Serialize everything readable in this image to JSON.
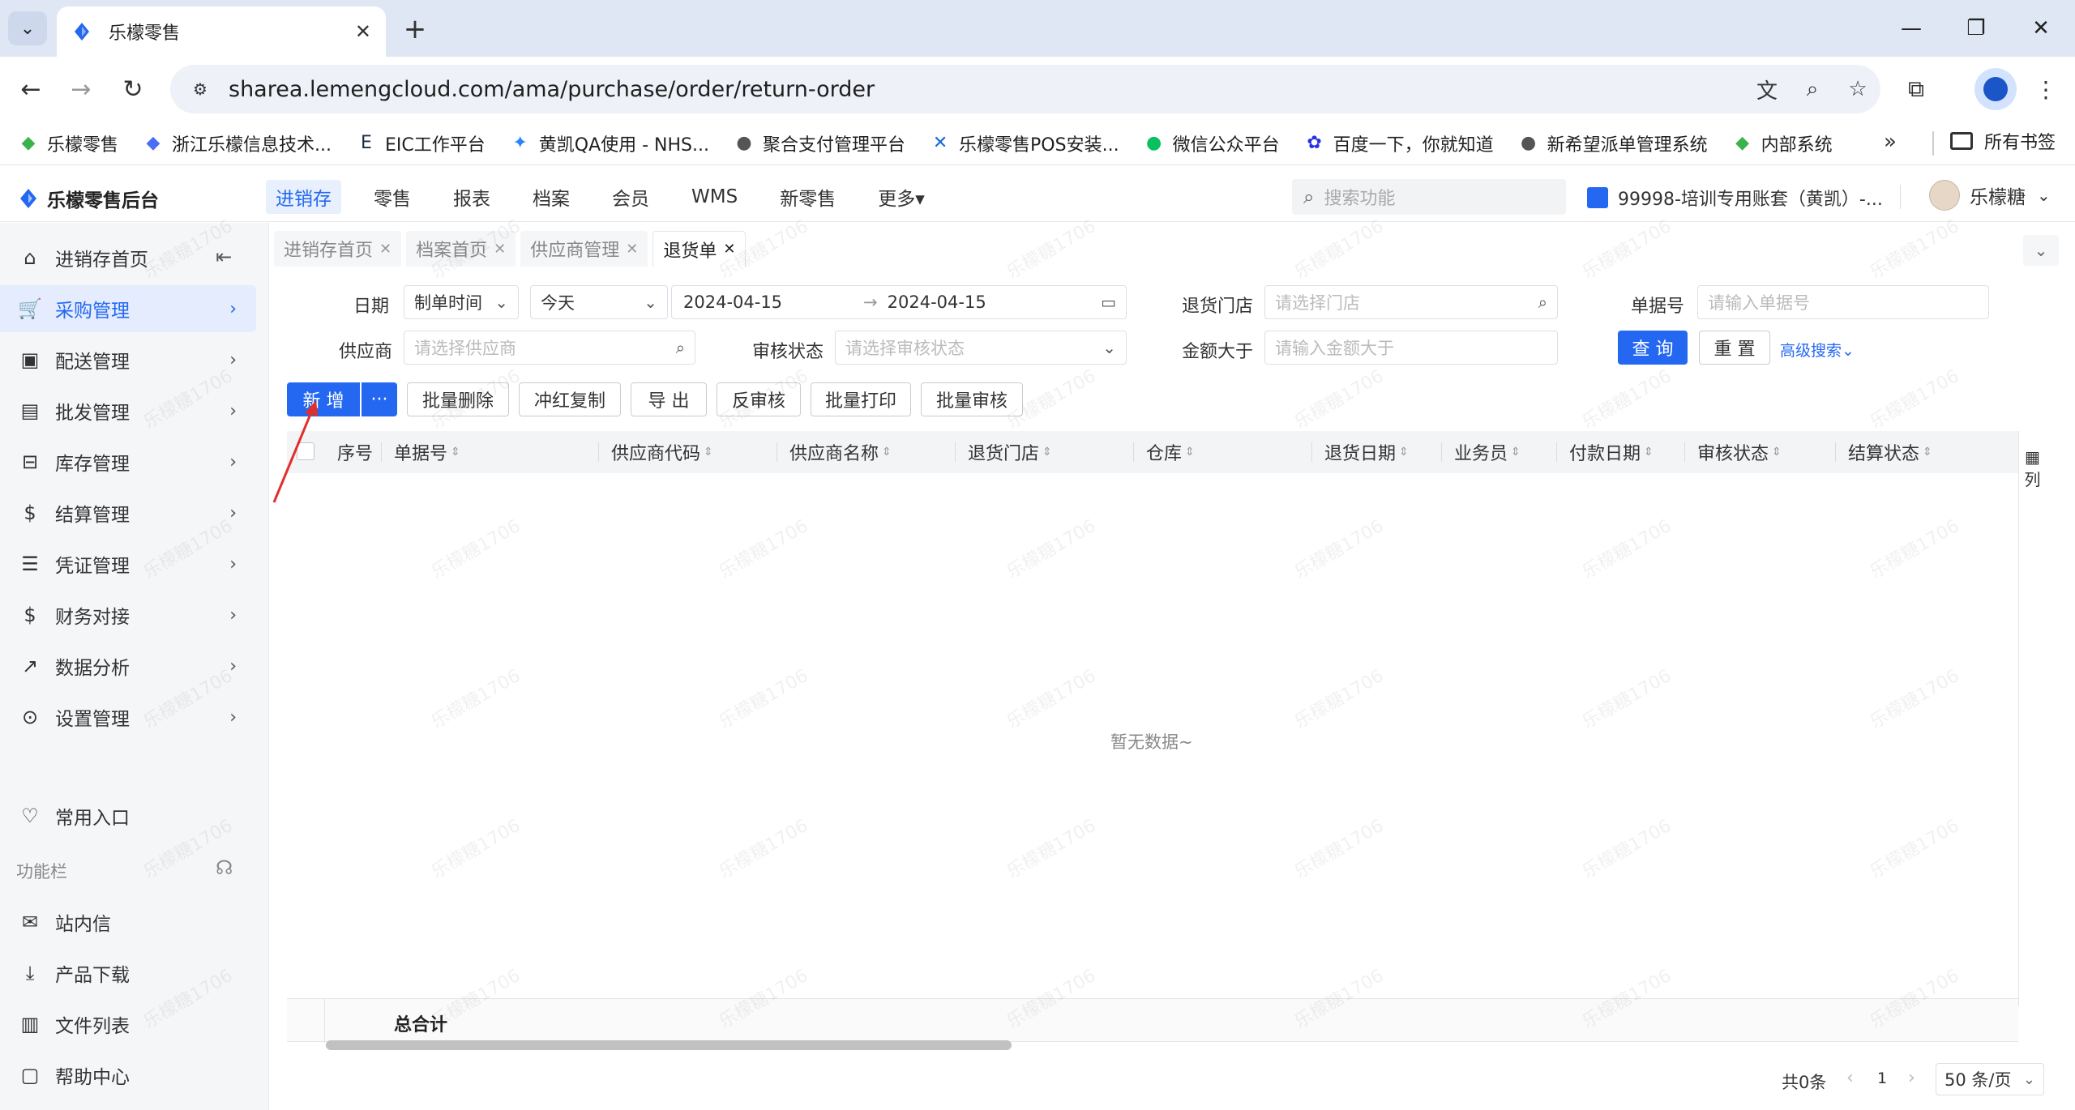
{
  "browser": {
    "tab_title": "乐檬零售",
    "url": "sharea.lemengcloud.com/ama/purchase/order/return-order",
    "bookmarks": [
      {
        "label": "乐檬零售",
        "icon": "lemeng-icon",
        "color": "#3bb34a"
      },
      {
        "label": "浙江乐檬信息技术...",
        "icon": "lemeng-blue-icon",
        "color": "#4a6cf7"
      },
      {
        "label": "EIC工作平台",
        "icon": "eic-icon",
        "color": "#1b2b4a"
      },
      {
        "label": "黄凯QA使用 - NHS...",
        "icon": "jira-icon",
        "color": "#2684ff"
      },
      {
        "label": "聚合支付管理平台",
        "icon": "globe-icon",
        "color": "#555555"
      },
      {
        "label": "乐檬零售POS安装...",
        "icon": "confluence-icon",
        "color": "#1868db"
      },
      {
        "label": "微信公众平台",
        "icon": "wechat-icon",
        "color": "#07c160"
      },
      {
        "label": "百度一下，你就知道",
        "icon": "baidu-icon",
        "color": "#2932e1"
      },
      {
        "label": "新希望派单管理系统",
        "icon": "globe-icon",
        "color": "#555555"
      },
      {
        "label": "内部系统",
        "icon": "lemeng-icon",
        "color": "#3bb34a"
      }
    ],
    "all_bookmarks": "所有书签"
  },
  "app": {
    "logo": "乐檬零售后台",
    "nav": [
      {
        "label": "进销存",
        "active": true
      },
      {
        "label": "零售",
        "active": false
      },
      {
        "label": "报表",
        "active": false
      },
      {
        "label": "档案",
        "active": false
      },
      {
        "label": "会员",
        "active": false
      },
      {
        "label": "WMS",
        "active": false
      },
      {
        "label": "新零售",
        "active": false
      },
      {
        "label": "更多▾",
        "active": false
      }
    ],
    "search_placeholder": "搜索功能",
    "account": "99998-培训专用账套（黄凯）-...",
    "user": "乐檬糖"
  },
  "sidebar": {
    "items": [
      {
        "label": "进销存首页",
        "icon": "home-icon",
        "active": false
      },
      {
        "label": "采购管理",
        "icon": "cart-icon",
        "active": true
      },
      {
        "label": "配送管理",
        "icon": "delivery-icon",
        "active": false
      },
      {
        "label": "批发管理",
        "icon": "wholesale-icon",
        "active": false
      },
      {
        "label": "库存管理",
        "icon": "inventory-icon",
        "active": false
      },
      {
        "label": "结算管理",
        "icon": "settlement-icon",
        "active": false
      },
      {
        "label": "凭证管理",
        "icon": "voucher-icon",
        "active": false
      },
      {
        "label": "财务对接",
        "icon": "finance-icon",
        "active": false
      },
      {
        "label": "数据分析",
        "icon": "chart-icon",
        "active": false
      },
      {
        "label": "设置管理",
        "icon": "settings-icon",
        "active": false
      }
    ],
    "favorites": "常用入口",
    "function_bar": "功能栏",
    "bottom_items": [
      {
        "label": "站内信",
        "icon": "mail-icon"
      },
      {
        "label": "产品下载",
        "icon": "download-icon"
      },
      {
        "label": "文件列表",
        "icon": "file-list-icon"
      },
      {
        "label": "帮助中心",
        "icon": "help-icon"
      }
    ]
  },
  "page_tabs": [
    {
      "label": "进销存首页",
      "active": false
    },
    {
      "label": "档案首页",
      "active": false
    },
    {
      "label": "供应商管理",
      "active": false
    },
    {
      "label": "退货单",
      "active": true
    }
  ],
  "filters": {
    "date_label": "日期",
    "date_type": "制单时间",
    "date_range": "今天",
    "date_start": "2024-04-15",
    "date_end": "2024-04-15",
    "return_store_label": "退货门店",
    "return_store_placeholder": "请选择门店",
    "doc_no_label": "单据号",
    "doc_no_placeholder": "请输入单据号",
    "supplier_label": "供应商",
    "supplier_placeholder": "请选择供应商",
    "audit_label": "审核状态",
    "audit_placeholder": "请选择审核状态",
    "amount_label": "金额大于",
    "amount_placeholder": "请输入金额大于",
    "query": "查 询",
    "reset": "重 置",
    "advanced": "高级搜索"
  },
  "actions": {
    "add": "新 增",
    "more": "···",
    "batch_delete": "批量删除",
    "red_copy": "冲红复制",
    "export": "导 出",
    "unaudit": "反审核",
    "batch_print": "批量打印",
    "batch_audit": "批量审核"
  },
  "table": {
    "columns": [
      "序号",
      "单据号",
      "供应商代码",
      "供应商名称",
      "退货门店",
      "仓库",
      "退货日期",
      "业务员",
      "付款日期",
      "审核状态",
      "结算状态"
    ],
    "empty_text": "暂无数据~",
    "column_setting": "列",
    "total_label": "总合计"
  },
  "pagination": {
    "total": "共0条",
    "page": "1",
    "page_size": "50 条/页"
  },
  "watermark": "乐檬糖1706"
}
